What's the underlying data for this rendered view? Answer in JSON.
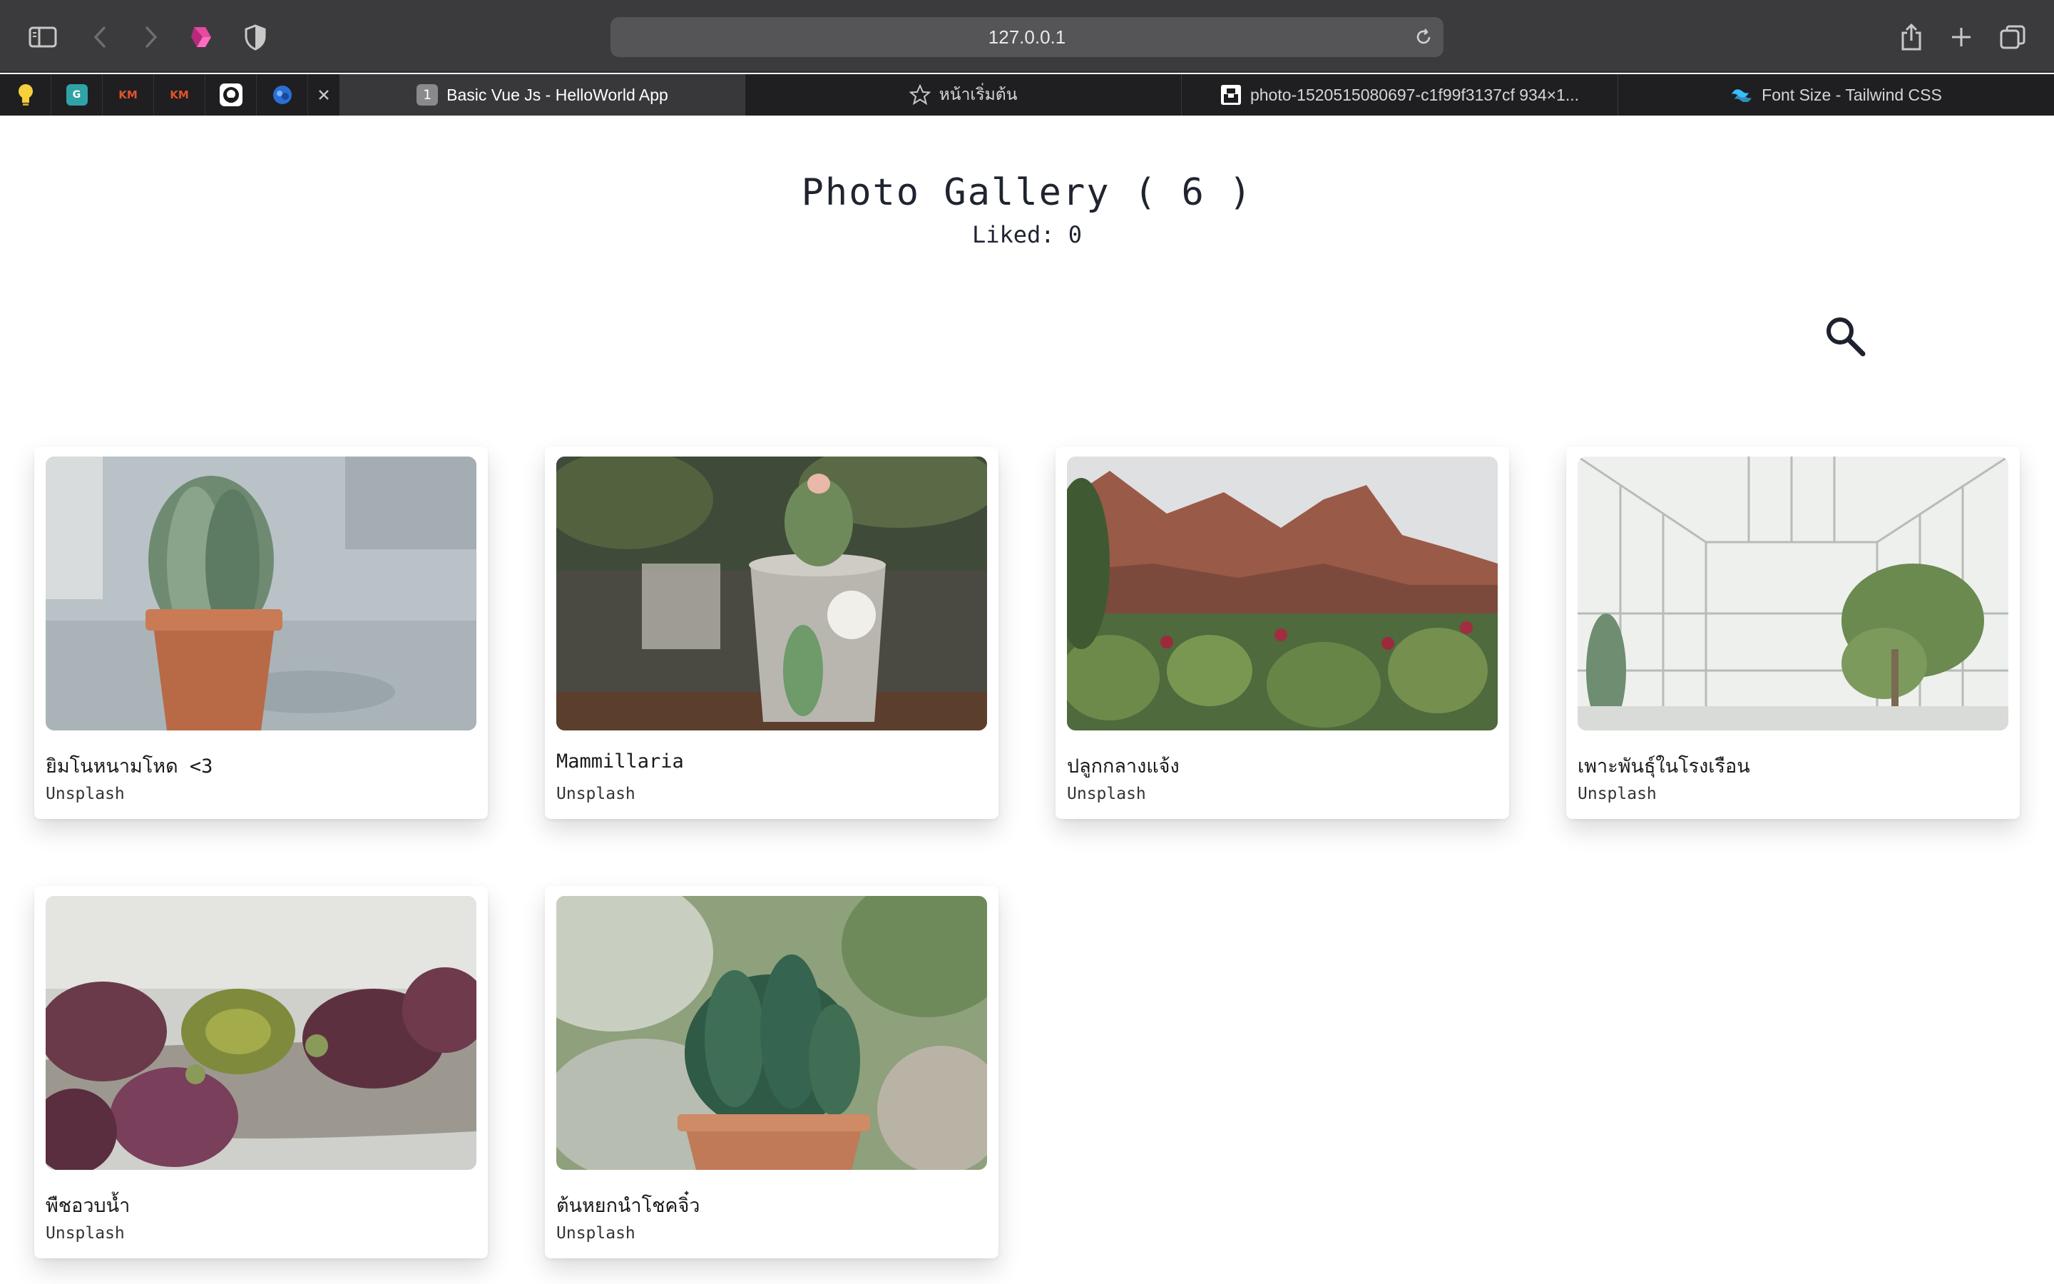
{
  "browser": {
    "address": "127.0.0.1",
    "tabs": [
      {
        "label": "Basic Vue Js - HelloWorld App",
        "badge": "1"
      },
      {
        "label": "หน้าเริ่มต้น"
      },
      {
        "label": "photo-1520515080697-c1f99f3137cf 934×1..."
      },
      {
        "label": "Font Size - Tailwind CSS"
      }
    ],
    "pinned_icons": [
      "lightbulb-icon",
      "gitkraken-icon",
      "kmutt-icon",
      "kmutt-icon",
      "github-icon",
      "bitwarden-icon"
    ]
  },
  "gallery": {
    "title": "Photo Gallery ( 6 )",
    "liked": "Liked: 0",
    "search_icon": "search-icon",
    "photos": [
      {
        "caption": "ยิมโนหนามโหด <3",
        "source": "Unsplash"
      },
      {
        "caption": "Mammillaria",
        "source": "Unsplash"
      },
      {
        "caption": "ปลูกกลางแจ้ง",
        "source": "Unsplash"
      },
      {
        "caption": "เพาะพันธุ์ในโรงเรือน",
        "source": "Unsplash"
      },
      {
        "caption": "พืชอวบน้ำ",
        "source": "Unsplash"
      },
      {
        "caption": "ต้นหยกนำโชคจิ๋ว",
        "source": "Unsplash"
      }
    ]
  }
}
